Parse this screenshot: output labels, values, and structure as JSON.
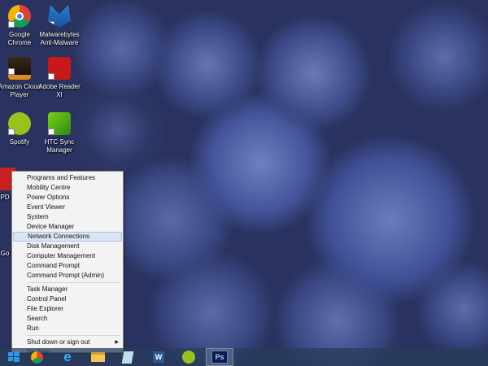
{
  "desktop_icons": [
    {
      "label": "Google Chrome",
      "icon": "chrome-icon"
    },
    {
      "label": "Malwarebytes Anti-Malware",
      "icon": "malwarebytes-icon"
    },
    {
      "label": "Amazon Cloud Player",
      "icon": "amazon-icon"
    },
    {
      "label": "Adobe Reader XI",
      "icon": "adobe-reader-icon"
    },
    {
      "label": "Spotify",
      "icon": "spotify-icon"
    },
    {
      "label": "HTC Sync Manager",
      "icon": "htc-sync-icon"
    },
    {
      "label": "PD",
      "icon": "pd-icon"
    },
    {
      "label": "Go",
      "icon": "go-icon"
    }
  ],
  "menu": {
    "group1": [
      "Programs and Features",
      "Mobility Centre",
      "Power Options",
      "Event Viewer",
      "System",
      "Device Manager",
      "Network Connections",
      "Disk Management",
      "Computer Management",
      "Command Prompt",
      "Command Prompt (Admin)"
    ],
    "group2": [
      "Task Manager",
      "Control Panel",
      "File Explorer",
      "Search",
      "Run"
    ],
    "group3": [
      "Shut down or sign out",
      "Desktop"
    ],
    "highlighted": "Network Connections"
  },
  "taskbar": {
    "items": [
      "start-icon",
      "chrome-icon",
      "internet-explorer-icon",
      "file-explorer-icon",
      "notepad-icon",
      "word-icon",
      "spotify-icon",
      "photoshop-icon"
    ],
    "active": "photoshop-icon",
    "ps_label": "Ps",
    "word_label": "W"
  }
}
